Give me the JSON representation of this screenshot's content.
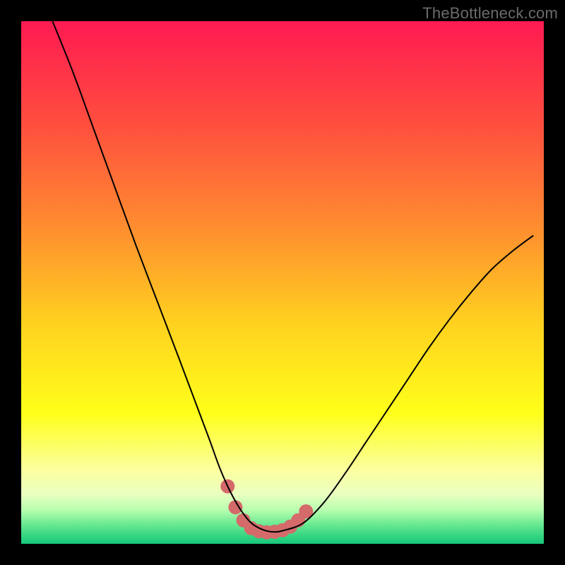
{
  "watermark": "TheBottleneck.com",
  "chart_data": {
    "type": "line",
    "title": "",
    "xlabel": "",
    "ylabel": "",
    "xlim": [
      0,
      100
    ],
    "ylim": [
      0,
      100
    ],
    "grid": false,
    "legend": false,
    "background_gradient": {
      "stops": [
        {
          "pos": 0.0,
          "color": "#ff1a52"
        },
        {
          "pos": 0.2,
          "color": "#ff4f3e"
        },
        {
          "pos": 0.4,
          "color": "#ff8f2f"
        },
        {
          "pos": 0.58,
          "color": "#ffd21f"
        },
        {
          "pos": 0.75,
          "color": "#ffff1a"
        },
        {
          "pos": 0.86,
          "color": "#fbffa0"
        },
        {
          "pos": 0.905,
          "color": "#e9ffc0"
        },
        {
          "pos": 0.935,
          "color": "#b8ffb0"
        },
        {
          "pos": 0.965,
          "color": "#63e78f"
        },
        {
          "pos": 1.0,
          "color": "#14c77a"
        }
      ]
    },
    "series": [
      {
        "name": "bottleneck-curve",
        "color": "#000000",
        "width": 2,
        "x": [
          6,
          10,
          14,
          18,
          22,
          26,
          30,
          33,
          36,
          38,
          40,
          42,
          44,
          46,
          48,
          50,
          54,
          58,
          62,
          66,
          70,
          74,
          78,
          82,
          86,
          90,
          94,
          98
        ],
        "y": [
          100,
          90,
          79,
          68,
          57,
          46.5,
          36,
          28,
          20,
          14.5,
          10,
          6.5,
          4,
          2.8,
          2.3,
          2.5,
          4,
          8,
          13.5,
          19.5,
          25.5,
          31.5,
          37.5,
          43,
          48,
          52.5,
          56,
          59
        ]
      }
    ],
    "markers": {
      "name": "highlight-dots",
      "color": "#d46a6a",
      "radius": 10,
      "points": [
        {
          "x": 39.5,
          "y": 11
        },
        {
          "x": 41,
          "y": 7
        },
        {
          "x": 42.5,
          "y": 4.5
        },
        {
          "x": 44,
          "y": 3
        },
        {
          "x": 45.5,
          "y": 2.4
        },
        {
          "x": 47,
          "y": 2.2
        },
        {
          "x": 48.5,
          "y": 2.3
        },
        {
          "x": 50,
          "y": 2.6
        },
        {
          "x": 51.5,
          "y": 3.3
        },
        {
          "x": 53,
          "y": 4.5
        },
        {
          "x": 54.5,
          "y": 6.2
        }
      ]
    }
  }
}
